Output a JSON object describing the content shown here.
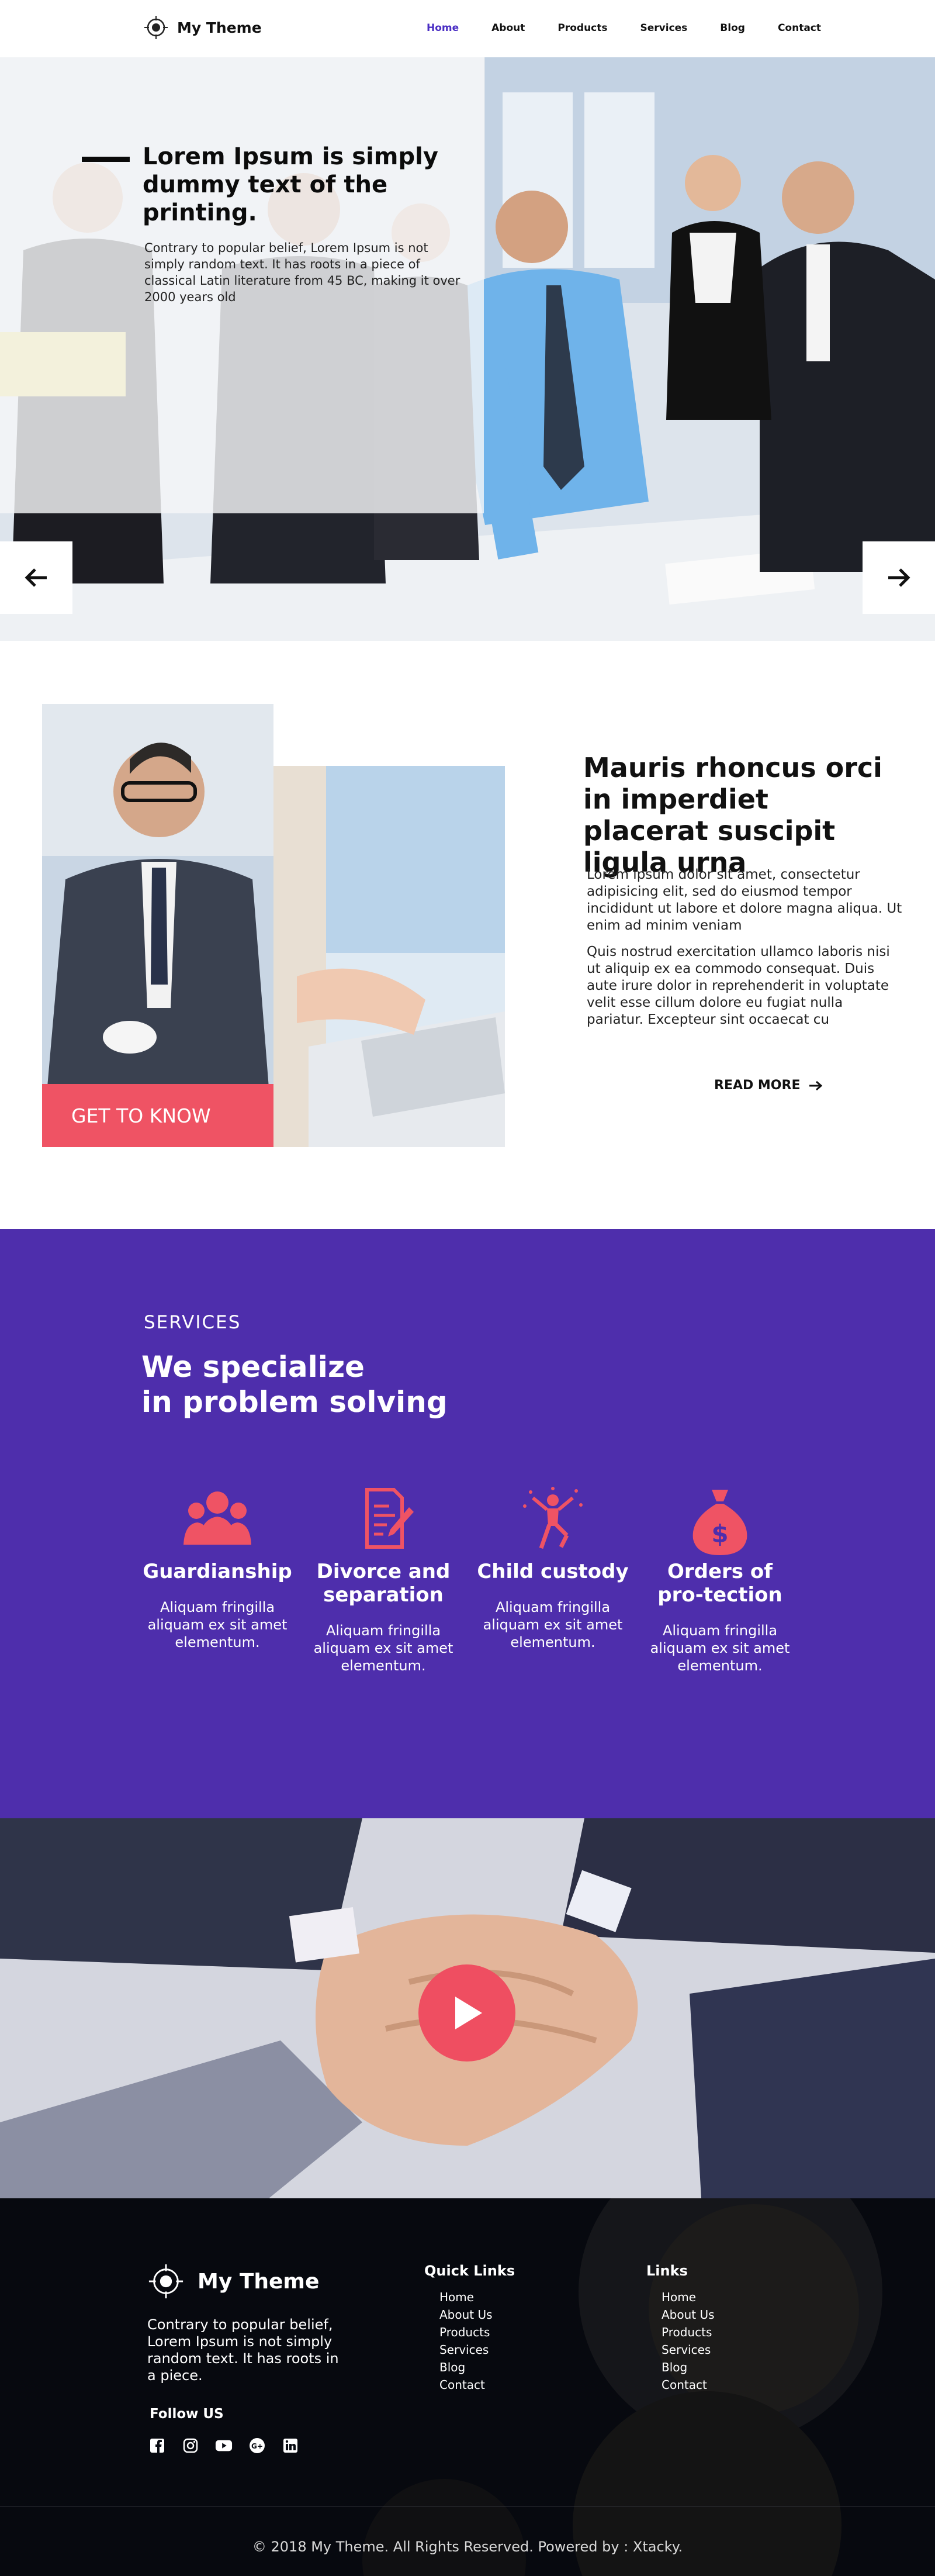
{
  "brand": {
    "name": "My Theme"
  },
  "nav": {
    "items": [
      {
        "label": "Home",
        "active": true
      },
      {
        "label": "About",
        "active": false
      },
      {
        "label": "Products",
        "active": false
      },
      {
        "label": "Services",
        "active": false
      },
      {
        "label": "Blog",
        "active": false
      },
      {
        "label": "Contact",
        "active": false
      }
    ]
  },
  "hero": {
    "title": "Lorem Ipsum is simply dummy text of the printing.",
    "text": "Contrary to popular belief, Lorem Ipsum is not simply random text. It has roots in a piece of classical Latin literature from 45 BC, making it over 2000 years old",
    "prev_icon": "arrow-left-icon",
    "next_icon": "arrow-right-icon"
  },
  "about": {
    "cta": "GET TO KNOW",
    "title": "Mauris rhoncus orci in imperdiet placerat suscipit ligula urna",
    "p1": "Lorem ipsum dolor sit amet, consectetur adipisicing elit, sed do eiusmod tempor incididunt ut labore et dolore magna aliqua. Ut enim ad minim veniam",
    "p2": "Quis nostrud exercitation ullamco laboris nisi ut aliquip ex ea commodo consequat. Duis aute irure dolor in reprehenderit in voluptate velit esse cillum dolore eu fugiat nulla pariatur. Excepteur sint occaecat cu",
    "read_more": "READ MORE"
  },
  "services": {
    "kicker": "SERVICES",
    "title_line1": "We specialize",
    "title_line2": "in problem solving",
    "items": [
      {
        "name": "Guardianship",
        "desc": "Aliquam fringilla aliquam  ex sit amet elementum.",
        "icon": "group-icon"
      },
      {
        "name": "Divorce and separation",
        "desc": "Aliquam fringilla aliquam  ex sit amet elementum.",
        "icon": "document-pen-icon"
      },
      {
        "name": "Child custody",
        "desc": "Aliquam fringilla aliquam  ex sit amet elementum.",
        "icon": "celebration-icon"
      },
      {
        "name": "Orders of pro-tection",
        "desc": "Aliquam fringilla aliquam  ex sit amet elementum.",
        "icon": "money-bag-icon"
      }
    ],
    "accent": "#ef5364",
    "background": "#4e2eac"
  },
  "video": {
    "play_icon": "play-icon"
  },
  "footer": {
    "brand": "My Theme",
    "desc": "Contrary to popular belief, Lorem Ipsum is not simply random text. It has roots in a piece.",
    "follow": "Follow US",
    "social": [
      "facebook-icon",
      "instagram-icon",
      "youtube-icon",
      "google-plus-icon",
      "linkedin-icon"
    ],
    "quick_links": {
      "title": "Quick Links",
      "items": [
        "Home",
        "About Us",
        "Products",
        "Services",
        "Blog",
        "Contact"
      ]
    },
    "links": {
      "title": "Links",
      "items": [
        "Home",
        "About Us",
        "Products",
        "Services",
        "Blog",
        "Contact"
      ]
    },
    "copyright": "© 2018 My Theme. All Rights Reserved. Powered by : Xtacky."
  }
}
